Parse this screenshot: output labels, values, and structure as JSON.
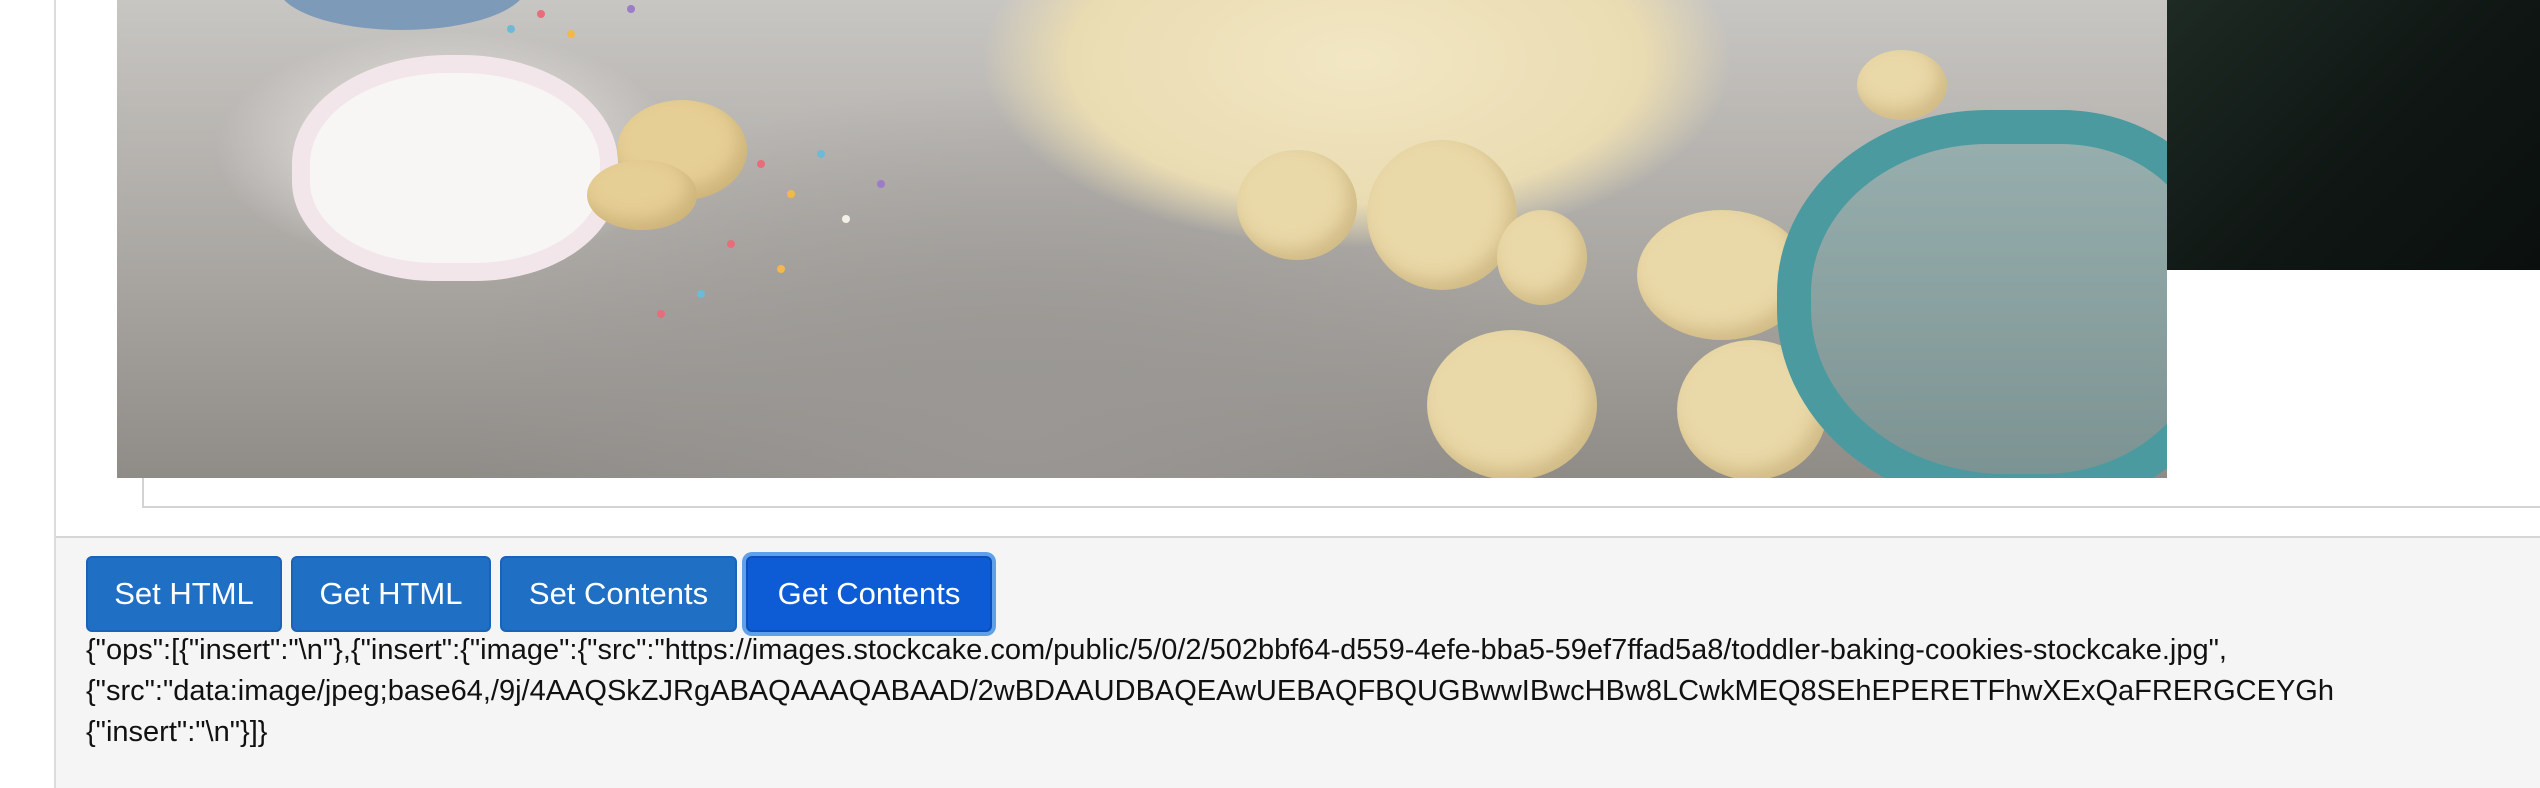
{
  "toolbar": {
    "buttons": [
      {
        "label": "Set HTML"
      },
      {
        "label": "Get HTML"
      },
      {
        "label": "Set Contents"
      },
      {
        "label": "Get Contents"
      }
    ]
  },
  "output": {
    "lines": [
      "{\"ops\":[{\"insert\":\"\\n\"},{\"insert\":{\"image\":{\"src\":\"https://images.stockcake.com/public/5/0/2/502bbf64-d559-4efe-bba5-59ef7ffad5a8/toddler-baking-cookies-stockcake.jpg\",",
      "{\"src\":\"data:image/jpeg;base64,/9j/4AAQSkZJRgABAQAAAQABAAD/2wBDAAUDBAQEAwUEBAQFBQUGBwwIBwcHBw8LCwkMEQ8SEhEPERETFhwXExQaFRERGCEYGh",
      "{\"insert\":\"\\n\"}]}"
    ]
  },
  "colors": {
    "button_bg": "#1f6fc5",
    "button_active_bg": "#0d5cd6",
    "toolbar_bg": "#f5f5f5"
  }
}
